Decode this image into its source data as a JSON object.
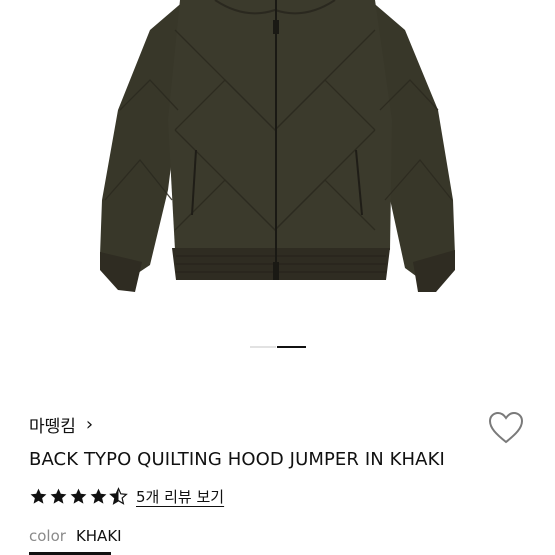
{
  "product": {
    "brand": "마뗑킴",
    "brand_chevron": "›",
    "title": "BACK TYPO QUILTING HOOD JUMPER IN KHAKI",
    "rating": 4.5,
    "review_link": "5개 리뷰 보기",
    "color_label": "color",
    "color_value": "KHAKI"
  },
  "gallery": {
    "slide_count": 2,
    "active_index": 1
  },
  "colors": {
    "jacket": "#3b3a2c",
    "rib": "#2f2c22",
    "star": "#111111",
    "muted": "#8a8a8a"
  },
  "icons": {
    "favorite": "heart-outline-icon",
    "brand_link": "chevron-right-icon",
    "rating": "star-icon"
  }
}
